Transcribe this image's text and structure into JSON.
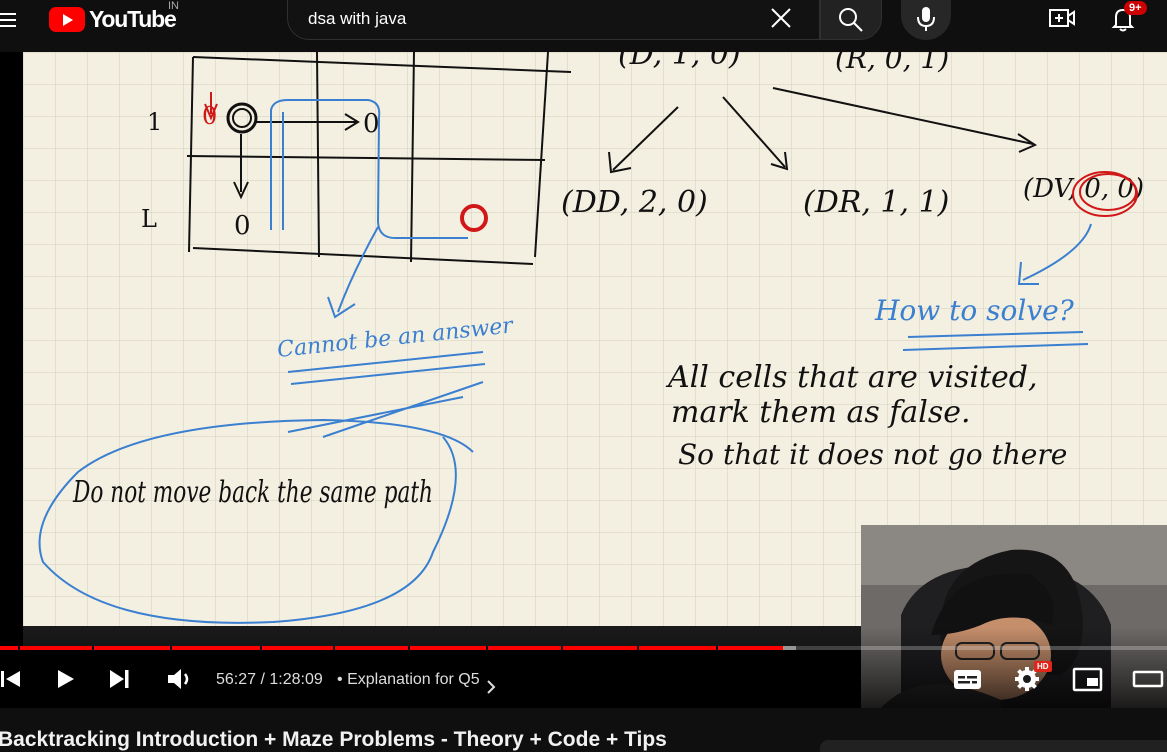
{
  "header": {
    "logo_text": "YouTube",
    "country_code": "IN",
    "search_value": "dsa with java",
    "notification_count": "9+"
  },
  "player": {
    "current_time": "56:27",
    "duration": "1:28:09",
    "time_display": "56:27 / 1:28:09",
    "chapter_separator": "•",
    "chapter_title": "Explanation for Q5",
    "progress_played": 0.671,
    "progress_loaded": 0.682,
    "hd_badge": "HD"
  },
  "whiteboard": {
    "row_labels": [
      "1",
      "L"
    ],
    "grid_cells": [
      "0",
      "0",
      "0",
      "0"
    ],
    "tuples": [
      "(DD, 2, 0)",
      "(DR, 1, 1)",
      "(DV, 0, 0)"
    ],
    "top_tuples": [
      "(D, 1, 0)",
      "(R, 0, 1)"
    ],
    "note_cannot": "Cannot be an answer",
    "note_path": "Do not move back the same path",
    "note_how": "How to solve?",
    "note_line1": "All cells that are visited,",
    "note_line2": "mark them as false.",
    "note_line3": "So that it does not go there"
  },
  "video_title": "Backtracking Introduction + Maze Problems - Theory + Code + Tips"
}
